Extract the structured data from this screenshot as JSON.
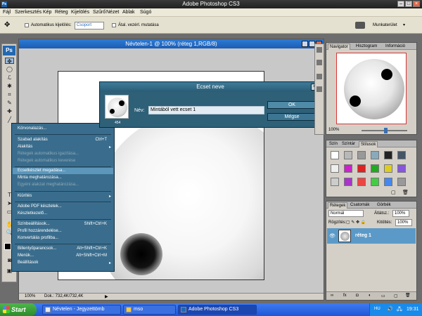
{
  "titlebar": {
    "title": "Adobe Photoshop CS3",
    "app_icon": "Ps"
  },
  "menubar": [
    "Fájl",
    "Szerkesztés",
    "Kép",
    "Réteg",
    "Kijelölés",
    "Szűrő",
    "Nézet",
    "Ablak",
    "Súgó"
  ],
  "options": {
    "auto_select_label": "Automatikus kijelölés:",
    "auto_select_value": "Csoport",
    "transform_label": "Átal. vezérl. mutatása",
    "workspace_label": "Munkaterület"
  },
  "toolbox": {
    "logo": "Ps"
  },
  "document": {
    "title": "Névtelen-1 @ 100% (réteg 1,RGB/8)",
    "zoom": "100%",
    "doc_info": "Dok.: 732,4K/732,4K"
  },
  "context_menu": [
    {
      "label": "Körvonalazás...",
      "disabled": false
    },
    {
      "label": "Szabad alakítás",
      "shortcut": "Ctrl+T",
      "disabled": false
    },
    {
      "label": "Alakítás",
      "submenu": true,
      "disabled": false
    },
    {
      "label": "Rétegek automatikus igazítása...",
      "disabled": true
    },
    {
      "label": "Rétegek automatikus keverése",
      "disabled": true
    },
    {
      "label": "Ecsetkészlet megadása...",
      "highlighted": true,
      "disabled": false
    },
    {
      "label": "Minta meghatározása...",
      "disabled": false
    },
    {
      "label": "Egyéni alakzat meghatározása...",
      "disabled": true
    },
    {
      "label": "Kiürítés",
      "submenu": true,
      "disabled": false
    },
    {
      "label": "Adobe PDF készletek...",
      "disabled": false
    },
    {
      "label": "Készletkezelő...",
      "disabled": false
    },
    {
      "label": "Színbeállítások...",
      "shortcut": "Shift+Ctrl+K",
      "disabled": false
    },
    {
      "label": "Profil hozzárendelése...",
      "disabled": false
    },
    {
      "label": "Konvertálás profilba...",
      "disabled": false
    },
    {
      "label": "Billentyűparancsok...",
      "shortcut": "Alt+Shift+Ctrl+K",
      "disabled": false
    },
    {
      "label": "Menük...",
      "shortcut": "Alt+Shift+Ctrl+M",
      "disabled": false
    },
    {
      "label": "Beállítások",
      "submenu": true,
      "disabled": false
    }
  ],
  "dialog": {
    "title": "Ecset neve",
    "name_label": "Név:",
    "name_value": "Mintából vett ecset 1",
    "ok_label": "OK",
    "cancel_label": "Mégse",
    "brush_size": "454"
  },
  "navigator": {
    "tabs": [
      "Navigator",
      "Hisztogram",
      "Információ"
    ],
    "zoom": "100%"
  },
  "styles": {
    "tabs": [
      "Szín",
      "Színtár",
      "Stílusok"
    ]
  },
  "layers": {
    "tabs": [
      "Rétegek",
      "Csatornák",
      "Görbék"
    ],
    "blend_mode": "Normál",
    "opacity_label": "Átlátsz.:",
    "opacity_value": "100%",
    "lock_label": "Rögzítés:",
    "fill_label": "Kitöltés:",
    "fill_value": "100%",
    "layer_name": "réteg 1"
  },
  "taskbar": {
    "start": "Start",
    "tasks": [
      "Névtelen - Jegyzettömb",
      "mso",
      "Adobe Photoshop CS3"
    ],
    "lang": "HU",
    "clock": "19:31"
  },
  "colors": {
    "menu_bg": "#3a6d8d",
    "menu_highlight": "#5c96bb",
    "dialog_bg": "#2e6078",
    "taskbar": "#245edb",
    "start_green": "#3a9b37"
  }
}
